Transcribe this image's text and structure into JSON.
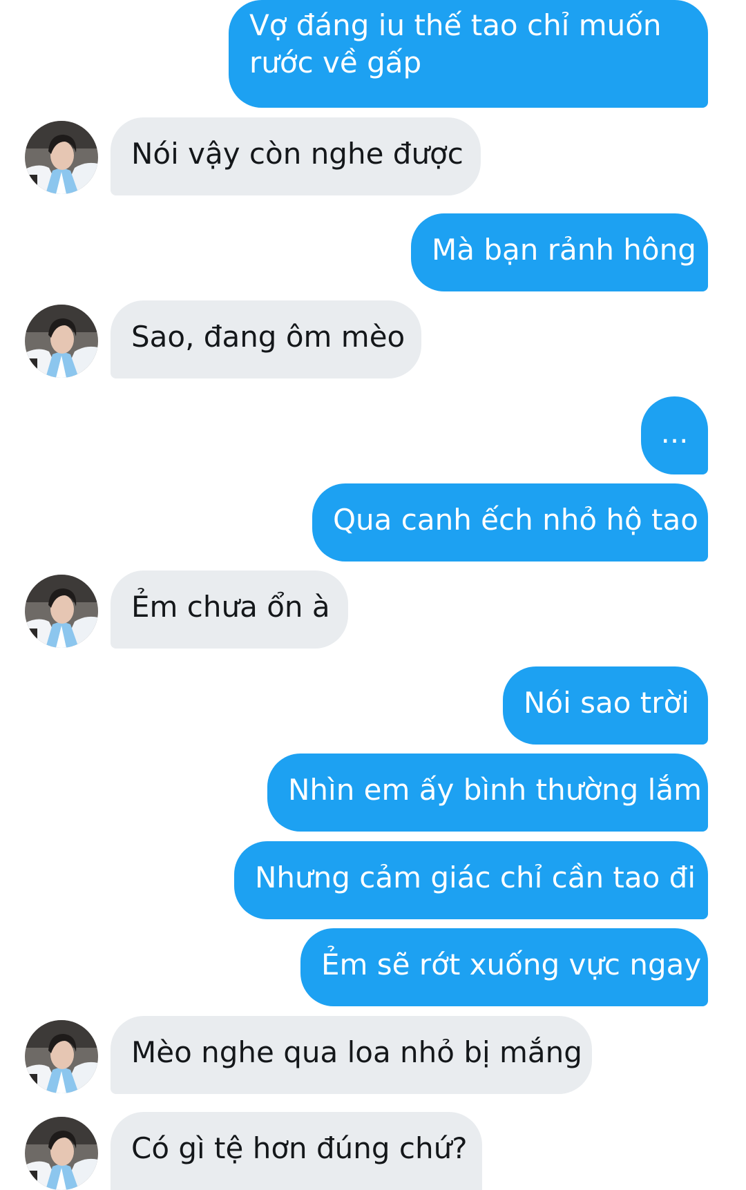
{
  "colors": {
    "sent_bubble": "#1da1f2",
    "received_bubble": "#e9ecef",
    "sent_text": "#ffffff",
    "received_text": "#14171a"
  },
  "messages": [
    {
      "from": "me",
      "text_line1": "Vợ đáng iu thế tao chỉ muốn",
      "text_line2": "rước về gấp"
    },
    {
      "from": "friend",
      "text": "Nói vậy còn nghe được"
    },
    {
      "from": "me",
      "text": "Mà bạn rảnh hông"
    },
    {
      "from": "friend",
      "text": "Sao, đang ôm mèo"
    },
    {
      "from": "me",
      "text": "..."
    },
    {
      "from": "me",
      "text": "Qua canh ếch nhỏ hộ tao"
    },
    {
      "from": "friend",
      "text": "Ẻm chưa ổn à"
    },
    {
      "from": "me",
      "text": "Nói sao trời"
    },
    {
      "from": "me",
      "text": "Nhìn em ấy bình thường lắm"
    },
    {
      "from": "me",
      "text": "Nhưng cảm giác chỉ cần tao đi"
    },
    {
      "from": "me",
      "text": "Ẻm sẽ rớt xuống vực ngay"
    },
    {
      "from": "friend",
      "text": "Mèo nghe qua loa nhỏ bị mắng"
    },
    {
      "from": "friend",
      "text": "Có gì tệ hơn đúng chứ?"
    }
  ]
}
